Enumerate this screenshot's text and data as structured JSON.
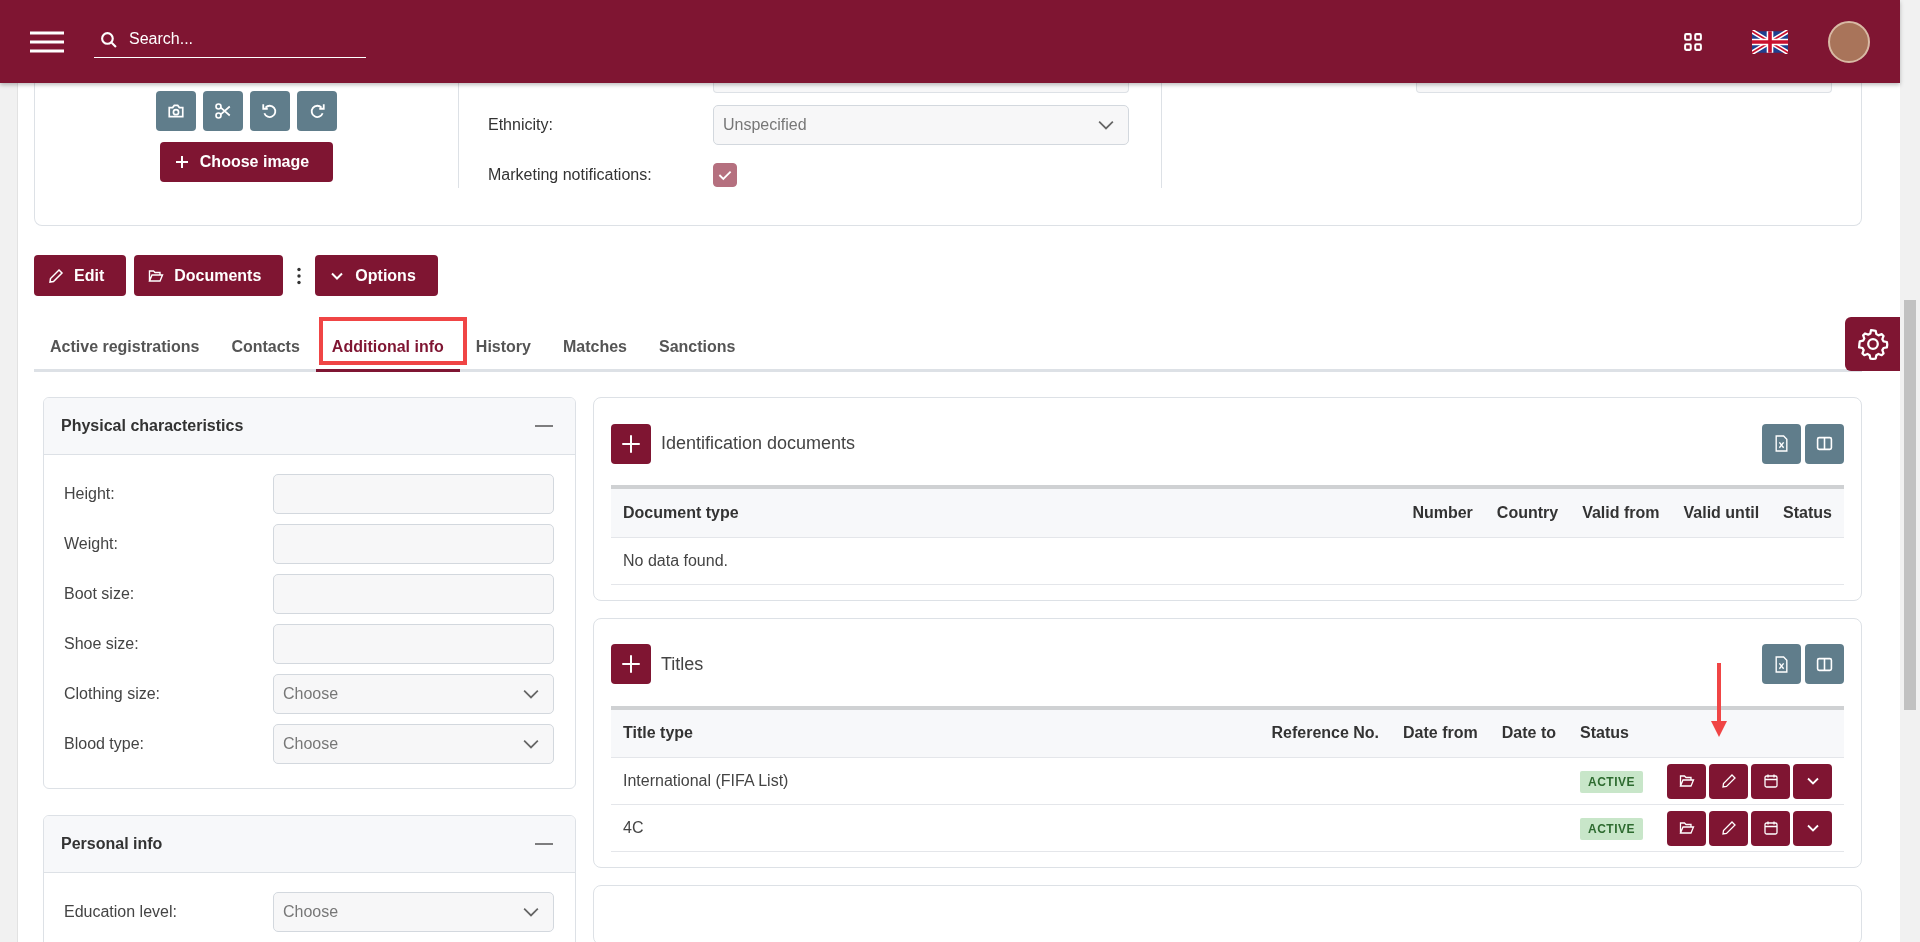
{
  "header": {
    "search_placeholder": "Search..."
  },
  "profile_card": {
    "choose_image_button": "Choose image",
    "fields": [
      {
        "label": "Ethnicity:",
        "kind": "select",
        "value": "Unspecified"
      },
      {
        "label": "Marketing notifications:",
        "kind": "checkbox",
        "checked": true
      }
    ]
  },
  "actions": {
    "buttons": [
      "Edit",
      "Documents"
    ],
    "options_button": "Options"
  },
  "tabs": [
    {
      "label": "Active registrations",
      "selected": false
    },
    {
      "label": "Contacts",
      "selected": false
    },
    {
      "label": "Additional info",
      "selected": true
    },
    {
      "label": "History",
      "selected": false
    },
    {
      "label": "Matches",
      "selected": false
    },
    {
      "label": "Sanctions",
      "selected": false
    }
  ],
  "physical_characteristics": {
    "title": "Physical characteristics",
    "fields": [
      {
        "label": "Height:",
        "kind": "text"
      },
      {
        "label": "Weight:",
        "kind": "text"
      },
      {
        "label": "Boot size:",
        "kind": "text"
      },
      {
        "label": "Shoe size:",
        "kind": "text"
      },
      {
        "label": "Clothing size:",
        "kind": "select",
        "placeholder": "Choose"
      },
      {
        "label": "Blood type:",
        "kind": "select",
        "placeholder": "Choose"
      }
    ]
  },
  "personal_info": {
    "title": "Personal info",
    "fields": [
      {
        "label": "Education level:",
        "kind": "select",
        "placeholder": "Choose"
      }
    ]
  },
  "identification_documents": {
    "title": "Identification documents",
    "columns": [
      "Document type",
      "Number",
      "Country",
      "Valid from",
      "Valid until",
      "Status"
    ],
    "empty_message": "No data found."
  },
  "titles": {
    "title": "Titles",
    "columns": [
      "Title type",
      "Reference No.",
      "Date from",
      "Date to",
      "Status"
    ],
    "rows": [
      {
        "cells": [
          "International (FIFA List)",
          "",
          "",
          "",
          ""
        ],
        "status": "ACTIVE"
      },
      {
        "cells": [
          "4C",
          "",
          "",
          "",
          ""
        ],
        "status": "ACTIVE"
      }
    ]
  }
}
